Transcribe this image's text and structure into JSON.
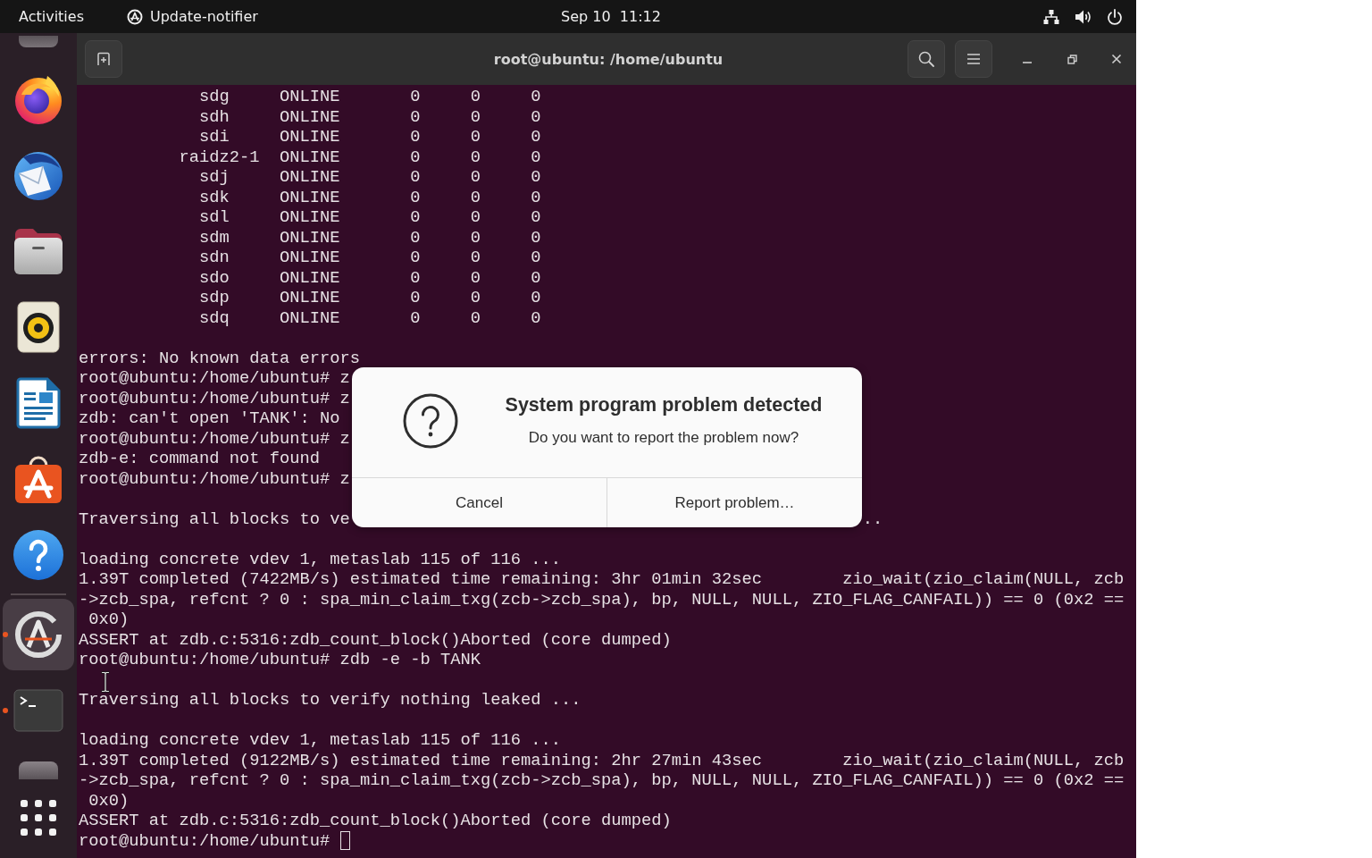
{
  "top_bar": {
    "activities": "Activities",
    "app_menu": "Update-notifier",
    "clock": "Sep 10  11:12"
  },
  "dock": {
    "favorites": [
      {
        "kind": "clipped_top",
        "running": false,
        "selected": false
      },
      {
        "kind": "browser",
        "running": false,
        "selected": false
      },
      {
        "kind": "mail",
        "running": false,
        "selected": false
      },
      {
        "kind": "files",
        "running": false,
        "selected": false
      },
      {
        "kind": "music",
        "running": false,
        "selected": false
      },
      {
        "kind": "writer",
        "running": false,
        "selected": false
      },
      {
        "kind": "store",
        "running": false,
        "selected": false
      },
      {
        "kind": "help",
        "running": false,
        "selected": false
      }
    ],
    "others": [
      {
        "kind": "updater",
        "running": true,
        "selected": true
      },
      {
        "kind": "terminal",
        "running": true,
        "selected": false
      },
      {
        "kind": "clipped_bottom",
        "running": false,
        "selected": false
      }
    ]
  },
  "terminal": {
    "title": "root@ubuntu: /home/ubuntu",
    "cursor": true,
    "blocks": [
      {
        "kind": "vdev_tree",
        "rows": [
          {
            "children": [
              {
                "name": "sdg",
                "state": "ONLINE",
                "column_3": "0",
                "column_4": "0",
                "column_5": "0"
              },
              {
                "name": "sdh",
                "state": "ONLINE",
                "column_3": "0",
                "column_4": "0",
                "column_5": "0"
              },
              {
                "name": "sdi",
                "state": "ONLINE",
                "column_3": "0",
                "column_4": "0",
                "column_5": "0"
              }
            ]
          },
          {
            "name": "raidz2-1",
            "state": "ONLINE",
            "column_3": "0",
            "column_4": "0",
            "column_5": "0",
            "children": [
              {
                "name": "sdj",
                "state": "ONLINE",
                "column_3": "0",
                "column_4": "0",
                "column_5": "0"
              },
              {
                "name": "sdk",
                "state": "ONLINE",
                "column_3": "0",
                "column_4": "0",
                "column_5": "0"
              },
              {
                "name": "sdl",
                "state": "ONLINE",
                "column_3": "0",
                "column_4": "0",
                "column_5": "0"
              },
              {
                "name": "sdm",
                "state": "ONLINE",
                "column_3": "0",
                "column_4": "0",
                "column_5": "0"
              },
              {
                "name": "sdn",
                "state": "ONLINE",
                "column_3": "0",
                "column_4": "0",
                "column_5": "0"
              },
              {
                "name": "sdo",
                "state": "ONLINE",
                "column_3": "0",
                "column_4": "0",
                "column_5": "0"
              },
              {
                "name": "sdp",
                "state": "ONLINE",
                "column_3": "0",
                "column_4": "0",
                "column_5": "0"
              },
              {
                "name": "sdq",
                "state": "ONLINE",
                "column_3": "0",
                "column_4": "0",
                "column_5": "0"
              }
            ]
          }
        ]
      },
      {
        "kind": "text",
        "lines": [
          "errors: No known data errors",
          "root@ubuntu:/home/ubuntu# z",
          "root@ubuntu:/home/ubuntu# z",
          "zdb: can't open 'TANK': No",
          "root@ubuntu:/home/ubuntu# z",
          "zdb-e: command not found",
          "root@ubuntu:/home/ubuntu# z"
        ]
      },
      {
        "kind": "covered_text",
        "text": "Traversing all blocks to ve",
        "tail": ".."
      },
      {
        "kind": "text",
        "lines": [
          "loading concrete vdev 1, metaslab 115 of 116 ...",
          "1.39T completed (7422MB/s) estimated time remaining: 3hr 01min 32sec        zio_wait(zio_claim(NULL, zcb",
          "->zcb_spa, refcnt ? 0 : spa_min_claim_txg(zcb->zcb_spa), bp, NULL, NULL, ZIO_FLAG_CANFAIL)) == 0 (0x2 ==",
          " 0x0)",
          "ASSERT at zdb.c:5316:zdb_count_block()Aborted (core dumped)",
          "root@ubuntu:/home/ubuntu# zdb -e -b TANK"
        ]
      },
      {
        "kind": "text",
        "lines": [
          "Traversing all blocks to verify nothing leaked ..."
        ]
      },
      {
        "kind": "text",
        "lines": [
          "loading concrete vdev 1, metaslab 115 of 116 ...",
          "1.39T completed (9122MB/s) estimated time remaining: 2hr 27min 43sec        zio_wait(zio_claim(NULL, zcb",
          "->zcb_spa, refcnt ? 0 : spa_min_claim_txg(zcb->zcb_spa), bp, NULL, NULL, ZIO_FLAG_CANFAIL)) == 0 (0x2 ==",
          " 0x0)",
          "ASSERT at zdb.c:5316:zdb_count_block()Aborted (core dumped)",
          "root@ubuntu:/home/ubuntu#"
        ]
      }
    ]
  },
  "dialog": {
    "title": "System program problem detected",
    "message": "Do you want to report the problem now?",
    "buttons": [
      "Cancel",
      "Report problem…"
    ]
  }
}
